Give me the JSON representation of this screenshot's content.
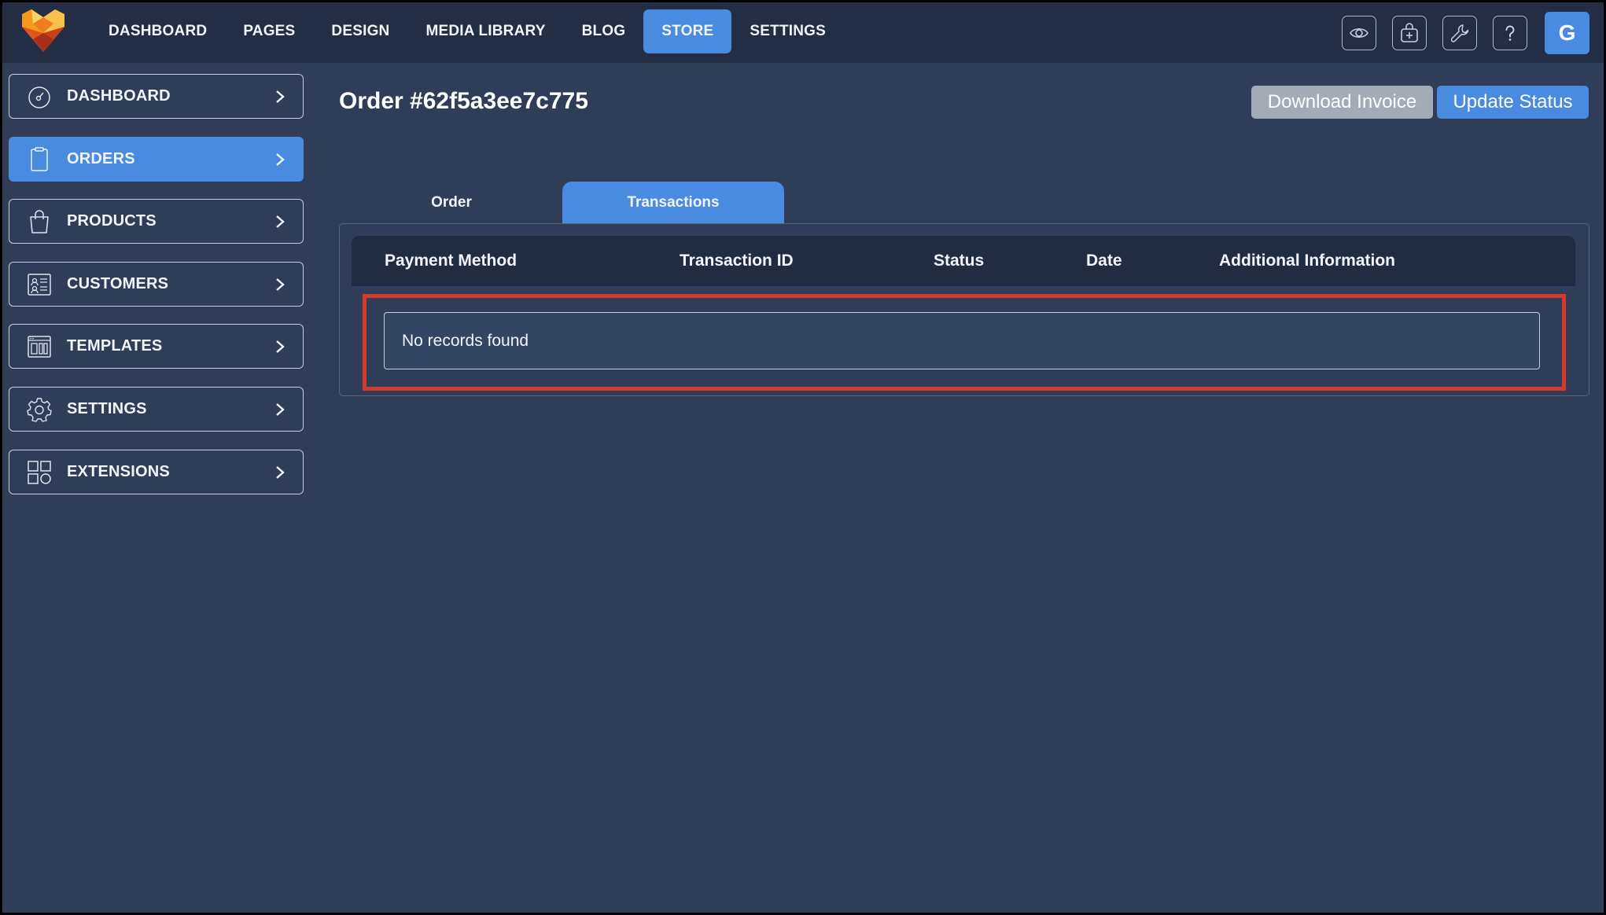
{
  "topnav": {
    "items": [
      {
        "label": "DASHBOARD"
      },
      {
        "label": "PAGES"
      },
      {
        "label": "DESIGN"
      },
      {
        "label": "MEDIA LIBRARY"
      },
      {
        "label": "BLOG"
      },
      {
        "label": "STORE",
        "active": true
      },
      {
        "label": "SETTINGS"
      }
    ],
    "icons": [
      "eye-icon",
      "add-to-bag-icon",
      "wrench-icon",
      "help-icon"
    ],
    "avatar_letter": "G"
  },
  "sidebar": {
    "items": [
      {
        "label": "DASHBOARD",
        "icon": "speedometer-icon"
      },
      {
        "label": "ORDERS",
        "icon": "clipboard-icon",
        "active": true
      },
      {
        "label": "PRODUCTS",
        "icon": "shopping-bag-icon"
      },
      {
        "label": "CUSTOMERS",
        "icon": "contact-card-icon"
      },
      {
        "label": "TEMPLATES",
        "icon": "layout-icon"
      },
      {
        "label": "SETTINGS",
        "icon": "gear-icon"
      },
      {
        "label": "EXTENSIONS",
        "icon": "apps-grid-icon"
      }
    ]
  },
  "main": {
    "title": "Order #62f5a3ee7c775",
    "download_invoice_label": "Download Invoice",
    "update_status_label": "Update Status",
    "tabs": [
      {
        "label": "Order"
      },
      {
        "label": "Transactions",
        "active": true
      }
    ],
    "table": {
      "columns": [
        "Payment Method",
        "Transaction ID",
        "Status",
        "Date",
        "Additional Information"
      ],
      "empty_text": "No records found"
    }
  },
  "colors": {
    "background": "#2f3d58",
    "topbar": "#232e44",
    "accent": "#4a8be2",
    "secondary_button": "#a2abb6",
    "highlight": "#d33a2c"
  }
}
